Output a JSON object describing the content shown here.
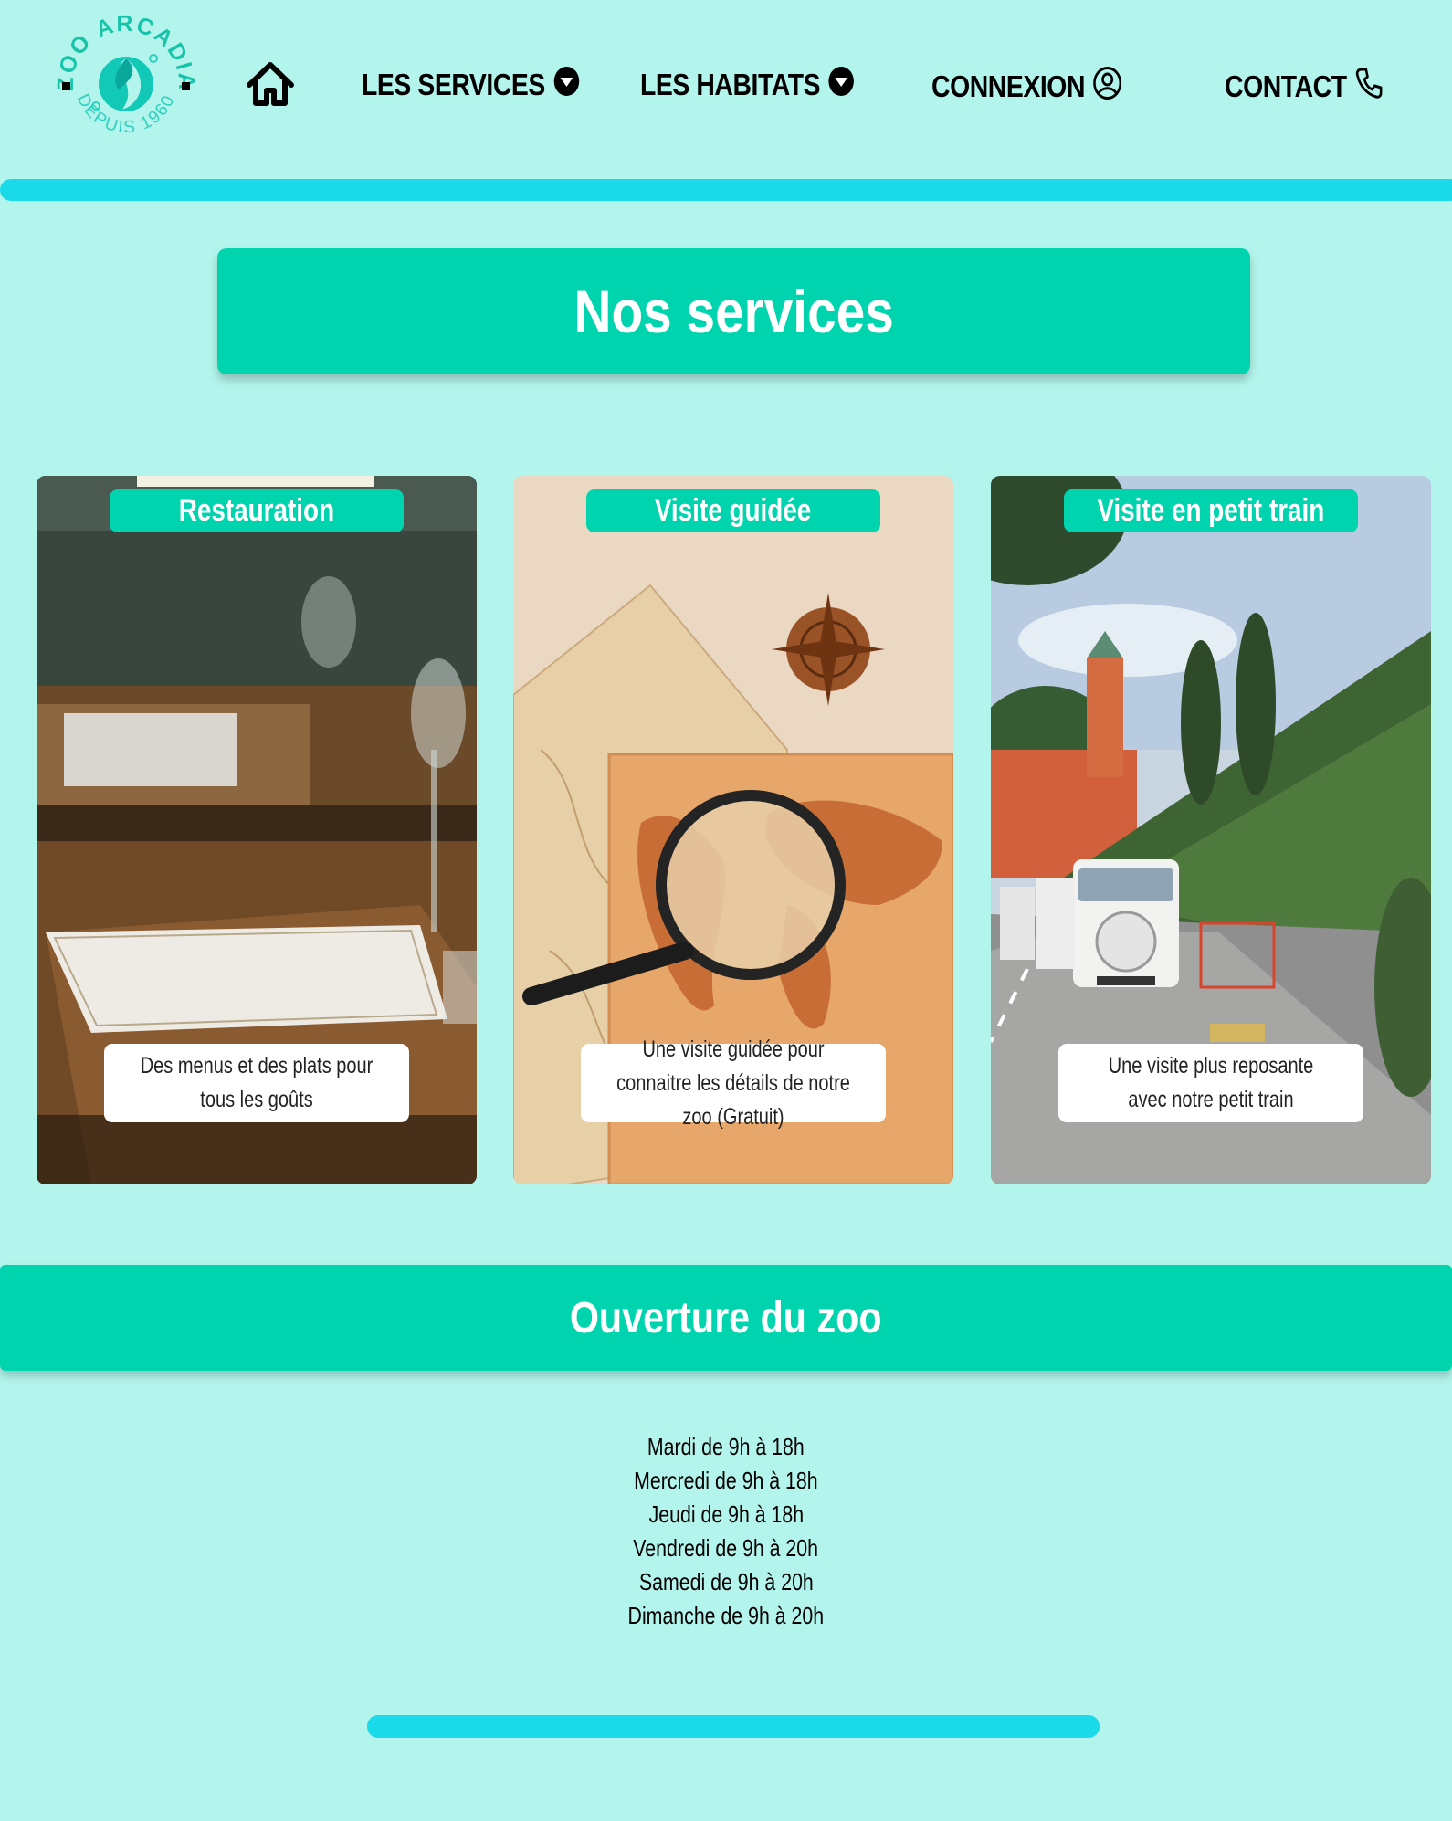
{
  "brand": {
    "name": "ZOO ARCADIA",
    "tagline": "DEPUIS 1960",
    "colors": {
      "background": "#b3f5ec",
      "accent": "#00d4ae",
      "rule": "#1ad9e9"
    }
  },
  "nav": {
    "home_icon": "home-icon",
    "items": [
      {
        "label": "LES SERVICES",
        "icon": "caret-down-circle-icon"
      },
      {
        "label": "LES HABITATS",
        "icon": "caret-down-circle-icon"
      },
      {
        "label": "CONNEXION",
        "icon": "user-circle-icon"
      },
      {
        "label": "CONTACT",
        "icon": "phone-icon"
      }
    ]
  },
  "services": {
    "title": "Nos services",
    "cards": [
      {
        "title": "Restauration",
        "description": "Des menus et des plats pour tous les goûts",
        "image": "restaurant-tables-photo"
      },
      {
        "title": "Visite guidée",
        "description": "Une visite guidée pour connaitre les détails de notre zoo (Gratuit)",
        "image": "map-magnifier-photo"
      },
      {
        "title": "Visite en petit train",
        "description": "Une visite plus reposante avec notre petit train",
        "image": "tourist-train-photo"
      }
    ]
  },
  "opening": {
    "title": "Ouverture du zoo",
    "days": [
      "Mardi de 9h à 18h",
      "Mercredi de 9h à 18h",
      "Jeudi de 9h à 18h",
      "Vendredi de 9h à 20h",
      "Samedi de 9h à 20h",
      "Dimanche de 9h à 20h"
    ]
  }
}
